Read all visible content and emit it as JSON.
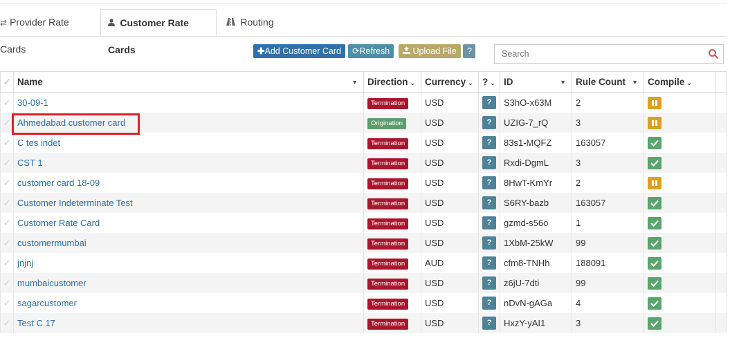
{
  "tabs": [
    {
      "label": "Provider Rate Cards",
      "icon": "exchange-arrows-icon",
      "active": false
    },
    {
      "label": "Customer Rate Cards",
      "icon": "user-icon",
      "active": true
    },
    {
      "label": "Routing",
      "icon": "road-icon",
      "active": false
    }
  ],
  "toolbar": {
    "add_label": "Add Customer Card",
    "refresh_label": "Refresh",
    "upload_label": "Upload File",
    "help_label": "?"
  },
  "search": {
    "placeholder": "Search"
  },
  "table": {
    "columns": {
      "name": "Name",
      "direction": "Direction",
      "currency": "Currency",
      "help": "?",
      "id": "ID",
      "rule_count": "Rule Count",
      "compile": "Compile"
    },
    "rows": [
      {
        "name": "30-09-1",
        "direction": "Termination",
        "currency": "USD",
        "help": "?",
        "id": "S3hO-x63M",
        "rule_count": "2",
        "compile": "pause"
      },
      {
        "name": "Ahmedabad customer card",
        "direction": "Origination",
        "currency": "USD",
        "help": "?",
        "id": "UZIG-7_rQ",
        "rule_count": "3",
        "compile": "pause"
      },
      {
        "name": "C tes indet",
        "direction": "Termination",
        "currency": "USD",
        "help": "?",
        "id": "83s1-MQFZ",
        "rule_count": "163057",
        "compile": "ok"
      },
      {
        "name": "CST 1",
        "direction": "Termination",
        "currency": "USD",
        "help": "?",
        "id": "Rxdi-DgmL",
        "rule_count": "3",
        "compile": "ok"
      },
      {
        "name": "customer card 18-09",
        "direction": "Termination",
        "currency": "USD",
        "help": "?",
        "id": "8HwT-KmYr",
        "rule_count": "2",
        "compile": "pause"
      },
      {
        "name": "Customer Indeterminate Test",
        "direction": "Termination",
        "currency": "USD",
        "help": "?",
        "id": "S6RY-bazb",
        "rule_count": "163057",
        "compile": "ok"
      },
      {
        "name": "Customer Rate Card",
        "direction": "Termination",
        "currency": "USD",
        "help": "?",
        "id": "gzmd-s56o",
        "rule_count": "1",
        "compile": "ok"
      },
      {
        "name": "customermumbai",
        "direction": "Termination",
        "currency": "USD",
        "help": "?",
        "id": "1XbM-25kW",
        "rule_count": "99",
        "compile": "ok"
      },
      {
        "name": "jnjnj",
        "direction": "Termination",
        "currency": "AUD",
        "help": "?",
        "id": "cfm8-TNHh",
        "rule_count": "188091",
        "compile": "ok"
      },
      {
        "name": "mumbaicustomer",
        "direction": "Termination",
        "currency": "USD",
        "help": "?",
        "id": "z6jU-7dti",
        "rule_count": "99",
        "compile": "ok"
      },
      {
        "name": "sagarcustomer",
        "direction": "Termination",
        "currency": "USD",
        "help": "?",
        "id": "nDvN-gAGa",
        "rule_count": "4",
        "compile": "ok"
      },
      {
        "name": "Test C 17",
        "direction": "Termination",
        "currency": "USD",
        "help": "?",
        "id": "HxzY-yAI1",
        "rule_count": "3",
        "compile": "ok"
      }
    ]
  },
  "colors": {
    "termination": "#a8152c",
    "origination": "#5e9c6b",
    "link": "#2a6fb0",
    "compile_ok": "#58a56d",
    "compile_pause": "#dca022",
    "highlight": "#e0202a"
  }
}
